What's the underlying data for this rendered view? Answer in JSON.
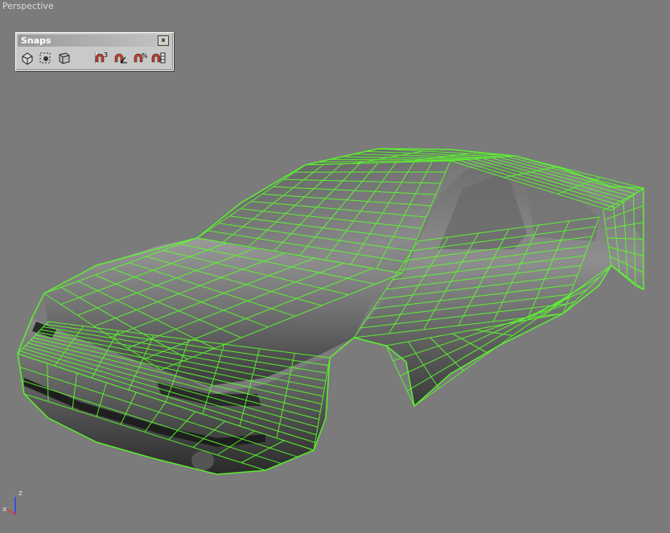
{
  "viewport": {
    "label": "Perspective",
    "background": "#7b7b7b",
    "wire_color": "#5aff2a"
  },
  "snaps_toolbar": {
    "title": "Snaps",
    "close_glyph": "×",
    "buttons": [
      {
        "name": "snap-toggle-icon"
      },
      {
        "name": "snap-selection-icon"
      },
      {
        "name": "snap-3d-box-icon"
      },
      {
        "name": "snap-magnet-3-icon",
        "badge": "3"
      },
      {
        "name": "angle-snap-icon"
      },
      {
        "name": "percent-snap-icon",
        "badge": "%"
      },
      {
        "name": "spinner-snap-icon"
      }
    ]
  },
  "axis_gizmo": {
    "z_label": "z",
    "x_label": "x"
  }
}
